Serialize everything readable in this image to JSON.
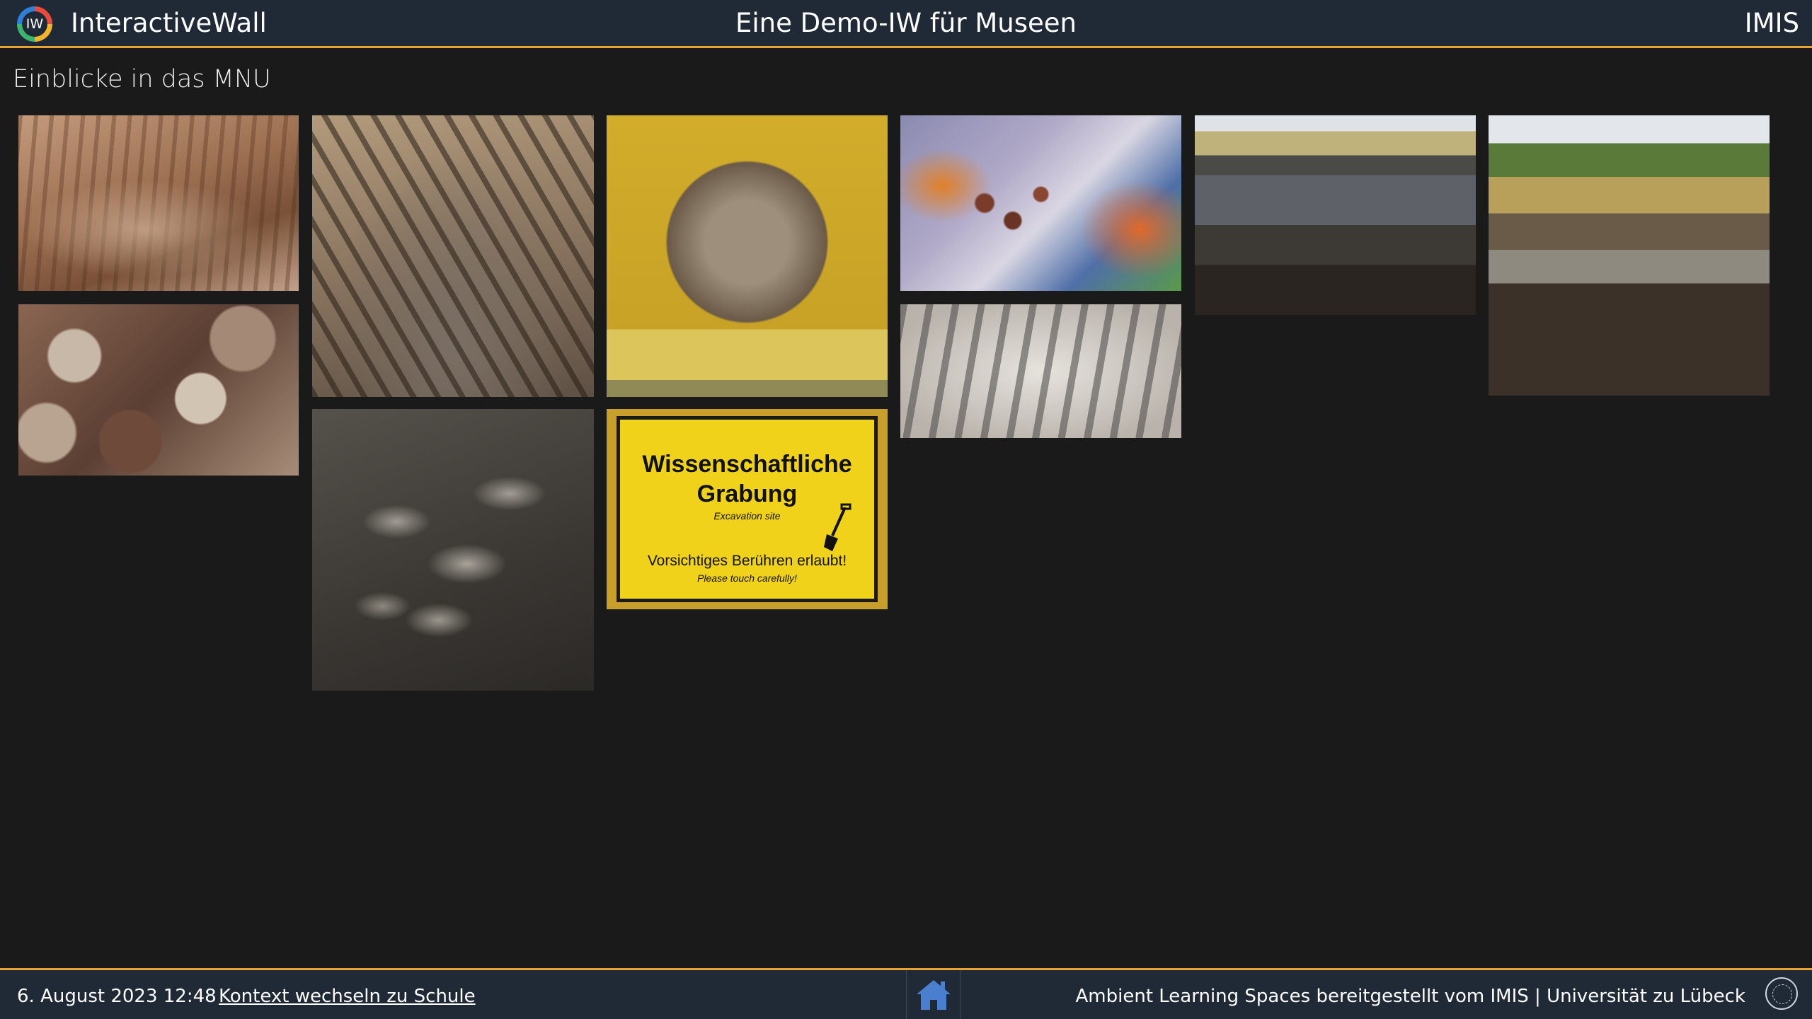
{
  "header": {
    "logo_text": "IW",
    "app_title": "InteractiveWall",
    "page_title": "Eine Demo-IW für Museen",
    "org": "IMIS"
  },
  "section": {
    "heading": "Einblicke in das MNU"
  },
  "tiles": [
    {
      "name": "sandstone-wall-photo"
    },
    {
      "name": "rock-rubble-photo"
    },
    {
      "name": "rib-bones-excavation-photo"
    },
    {
      "name": "rib-fragments-excavation-photo"
    },
    {
      "name": "clay-sphere-photo"
    },
    {
      "name": "excavation-sign-photo"
    },
    {
      "name": "geological-map-photo"
    },
    {
      "name": "skeleton-hand-photo"
    },
    {
      "name": "quarry-pit-photo"
    },
    {
      "name": "gravel-quarry-photo"
    }
  ],
  "sign": {
    "title": "Wissenschaftliche Grabung",
    "subtitle": "Excavation site",
    "warning": "Vorsichtiges Berühren erlaubt!",
    "warning_en": "Please touch carefully!"
  },
  "footer": {
    "datetime": "6. August 2023 12:48",
    "context_link": "Kontext wechseln zu Schule",
    "credit": "Ambient Learning Spaces bereitgestellt vom IMIS | Universität zu Lübeck"
  },
  "colors": {
    "bar_background": "#1f2a36",
    "accent": "#e8a230",
    "page_background": "#1a1a1a"
  },
  "icons": [
    "logo-icon",
    "home-icon",
    "university-seal-icon"
  ]
}
